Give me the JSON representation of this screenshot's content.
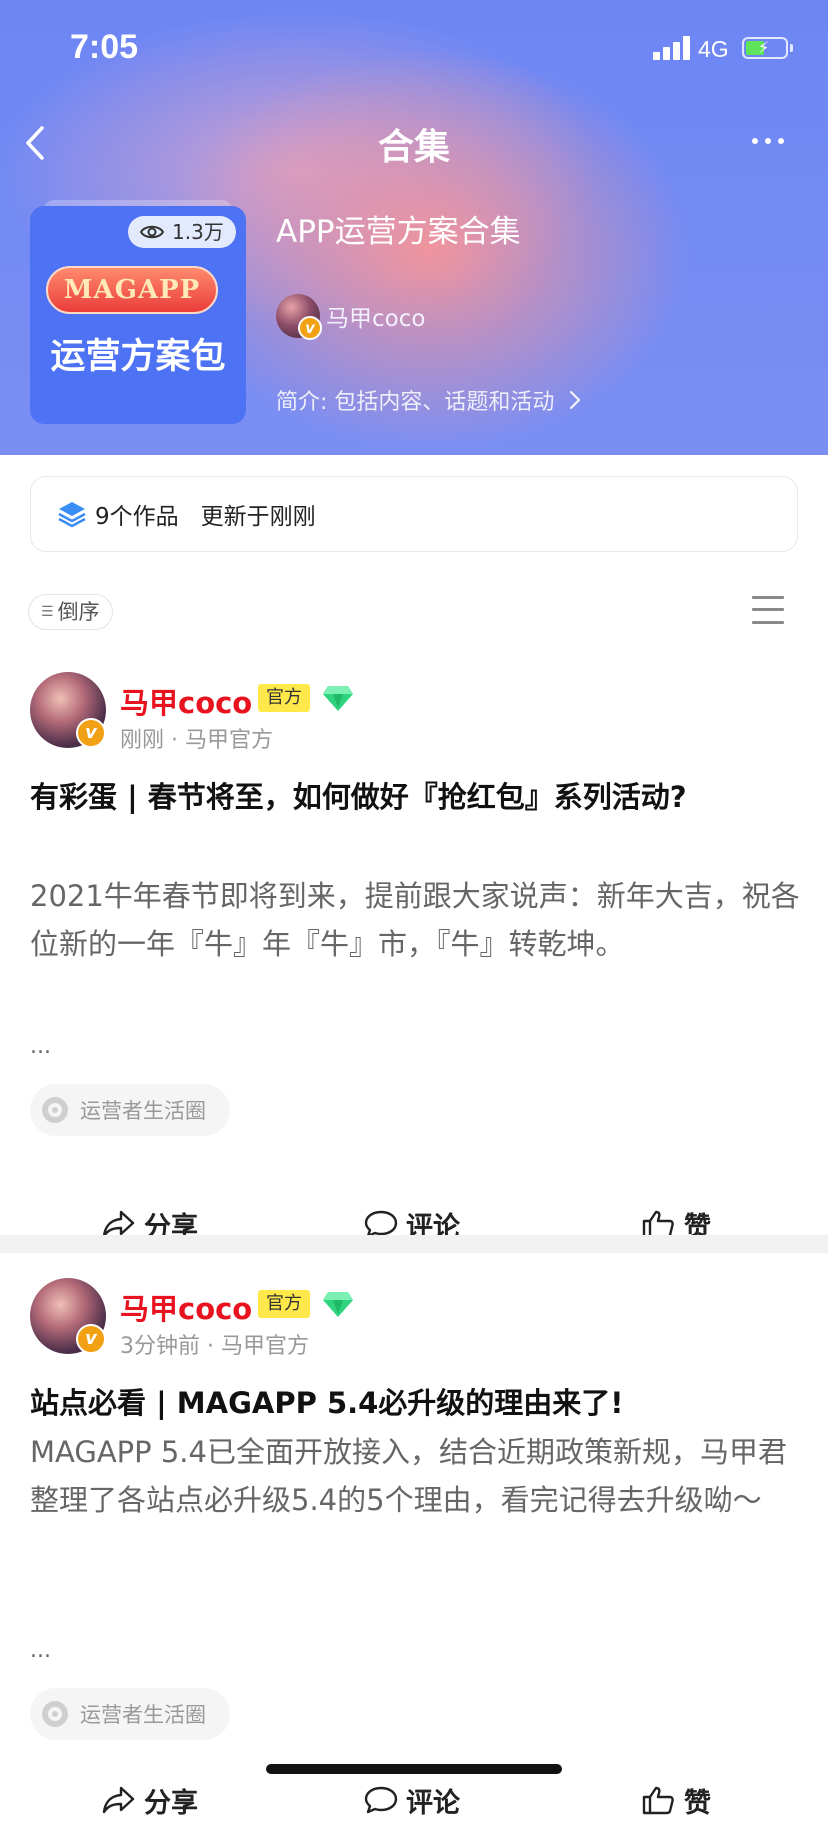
{
  "status_bar": {
    "time": "7:05",
    "network": "4G"
  },
  "nav": {
    "title": "合集"
  },
  "collection": {
    "views": "1.3万",
    "cover_badge": "MAGAPP",
    "cover_subtitle": "运营方案包",
    "title": "APP运营方案合集",
    "author": "马甲coco",
    "intro": "简介: 包括内容、话题和活动"
  },
  "stats": {
    "works": "9个作品",
    "updated": "更新于刚刚"
  },
  "sort": {
    "label": "倒序"
  },
  "posts": [
    {
      "author": "马甲coco",
      "official": "官方",
      "meta": "刚刚 · 马甲官方",
      "title": "有彩蛋 | 春节将至，如何做好『抢红包』系列活动?",
      "body": "2021牛年春节即将到来，提前跟大家说声：新年大吉，祝各位新的一年『牛』年『牛』市，『牛』转乾坤。",
      "ellipsis": "...",
      "tag": "运营者生活圈",
      "share": "分享",
      "comment": "评论",
      "like": "赞"
    },
    {
      "author": "马甲coco",
      "official": "官方",
      "meta": "3分钟前 · 马甲官方",
      "title": "站点必看 | MAGAPP 5.4必升级的理由来了!",
      "body": "MAGAPP 5.4已全面开放接入，结合近期政策新规，马甲君整理了各站点必升级5.4的5个理由，看完记得去升级呦～",
      "ellipsis": "...",
      "tag": "运营者生活圈",
      "share": "分享",
      "comment": "评论",
      "like": "赞"
    }
  ]
}
